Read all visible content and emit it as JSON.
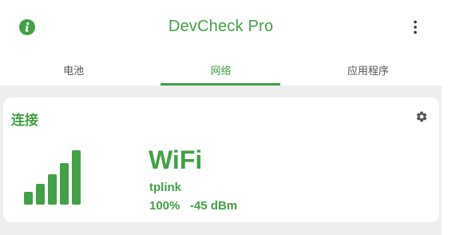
{
  "appbar": {
    "title": "DevCheck Pro",
    "info_icon": "info-icon",
    "more_icon": "more-vert-icon"
  },
  "tabs": [
    {
      "label": "电池",
      "active": false
    },
    {
      "label": "网络",
      "active": true
    },
    {
      "label": "应用程序",
      "active": false
    }
  ],
  "card": {
    "title": "连接",
    "settings_icon": "gear-icon",
    "signal_icon": "wifi-signal-bars-icon",
    "connection_type": "WiFi",
    "ssid": "tplink",
    "signal_percent": "100%",
    "signal_dbm": "-45 dBm"
  },
  "colors": {
    "accent": "#43a047",
    "background": "#eeeeee",
    "card": "#ffffff",
    "tab_inactive": "#555555"
  }
}
